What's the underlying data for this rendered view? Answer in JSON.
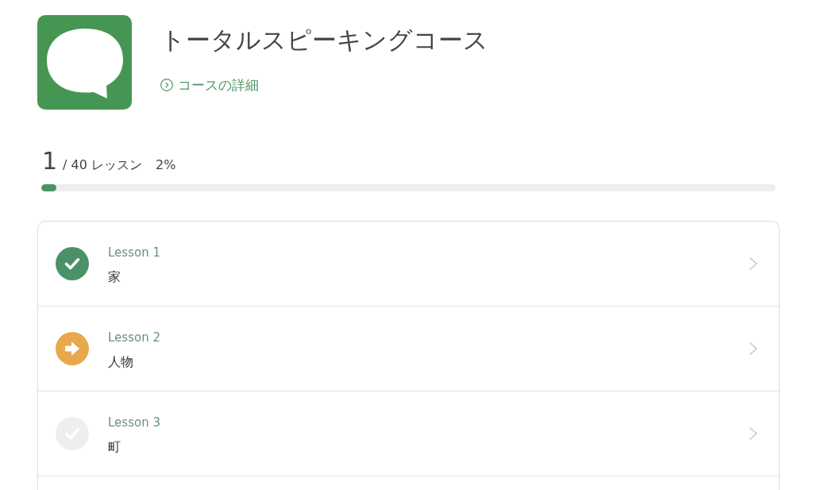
{
  "course": {
    "title": "トータルスピーキングコース",
    "details_link": "コースの詳細"
  },
  "progress": {
    "completed": "1",
    "total": "/ 40 レッスン",
    "percent": "2%",
    "level": 0.02
  },
  "lessons": [
    {
      "label": "Lesson 1",
      "title": "家",
      "completed": true,
      "current": false
    },
    {
      "label": "Lesson 2",
      "title": "人物",
      "completed": false,
      "current": true
    },
    {
      "label": "Lesson 3",
      "title": "町",
      "completed": false,
      "current": false
    }
  ]
}
